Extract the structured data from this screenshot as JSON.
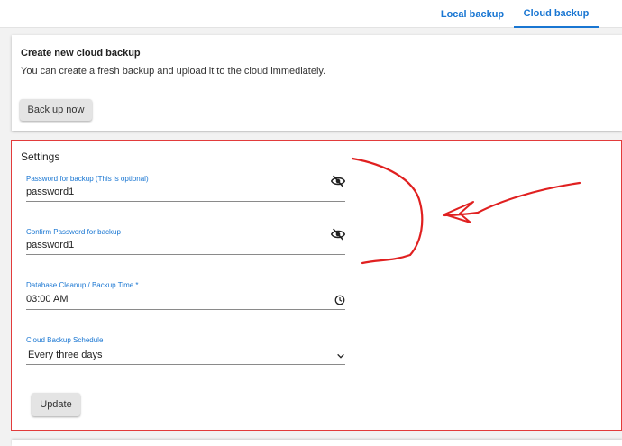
{
  "tabs": [
    {
      "label": "Local backup",
      "active": false
    },
    {
      "label": "Cloud backup",
      "active": true
    }
  ],
  "create_card": {
    "title": "Create new cloud backup",
    "description": "You can create a fresh backup and upload it to the cloud immediately.",
    "button_label": "Back up now"
  },
  "settings": {
    "title": "Settings",
    "password": {
      "label": "Password for backup (This is optional)",
      "value": "password1",
      "icon": "eye-off-icon"
    },
    "confirm_password": {
      "label": "Confirm Password for backup",
      "value": "password1",
      "icon": "eye-off-icon"
    },
    "backup_time": {
      "label": "Database Cleanup / Backup Time *",
      "value": "03:00 AM",
      "icon": "clock-icon"
    },
    "schedule": {
      "label": "Cloud Backup Schedule",
      "value": "Every three days",
      "icon": "chevron-down-icon"
    },
    "update_label": "Update"
  },
  "colors": {
    "accent": "#1976d2",
    "annotation": "#e02020"
  }
}
